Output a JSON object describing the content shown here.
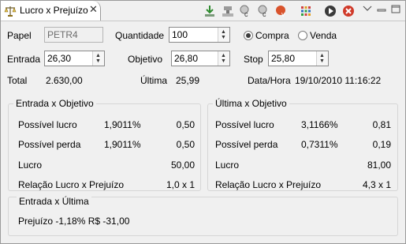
{
  "tab": {
    "title": "Lucro x Prejuízo",
    "icon": "scale-icon",
    "close_glyph": "✕"
  },
  "toolbar": {
    "icons": [
      "download-icon",
      "stamp-icon",
      "component-c-icon",
      "component-c-icon",
      "red-v-icon",
      "grid-icon",
      "play-icon",
      "stop-icon",
      "view-menu-icon"
    ]
  },
  "form": {
    "papel_label": "Papel",
    "papel_value": "PETR4",
    "quantidade_label": "Quantidade",
    "quantidade_value": "100",
    "compra_label": "Compra",
    "venda_label": "Venda",
    "entrada_label": "Entrada",
    "entrada_value": "26,30",
    "objetivo_label": "Objetivo",
    "objetivo_value": "26,80",
    "stop_label": "Stop",
    "stop_value": "25,80",
    "total_label": "Total",
    "total_value": "2.630,00",
    "ultima_label": "Última",
    "ultima_value": "25,99",
    "datahora_label": "Data/Hora",
    "datahora_value": "19/10/2010 11:16:22"
  },
  "entrada_objetivo": {
    "title": "Entrada x Objetivo",
    "rows": [
      {
        "label": "Possível lucro",
        "pct": "1,9011%",
        "value": "0,50"
      },
      {
        "label": "Possível perda",
        "pct": "1,9011%",
        "value": "0,50"
      },
      {
        "label": "Lucro",
        "pct": "",
        "value": "50,00"
      },
      {
        "label": "Relação Lucro x Prejuízo",
        "pct": "",
        "value": "1,0 x 1"
      }
    ]
  },
  "ultima_objetivo": {
    "title": "Última x Objetivo",
    "rows": [
      {
        "label": "Possível lucro",
        "pct": "3,1166%",
        "value": "0,81"
      },
      {
        "label": "Possível perda",
        "pct": "0,7311%",
        "value": "0,19"
      },
      {
        "label": "Lucro",
        "pct": "",
        "value": "81,00"
      },
      {
        "label": "Relação Lucro x Prejuízo",
        "pct": "",
        "value": "4,3 x 1"
      }
    ]
  },
  "entrada_ultima": {
    "title": "Entrada x Última",
    "summary": "Prejuízo -1,18%  R$ -31,00"
  }
}
